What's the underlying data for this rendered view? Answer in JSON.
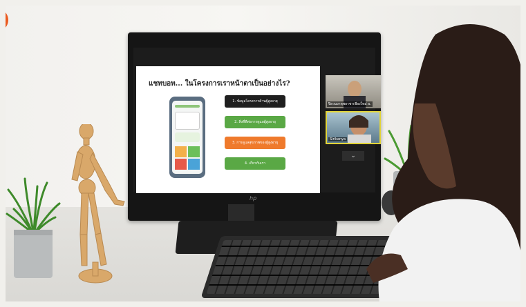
{
  "scene": {
    "description_colors": {
      "accent_badge": "#ea5a1f"
    }
  },
  "slide": {
    "title": "แชทบอท... ในโครงการเราหน้าตาเป็นอย่างไร?",
    "buttons": [
      {
        "label": "1. ข้อมูลโครงการด้านผู้สูงอายุ",
        "color": "#1f1f1f"
      },
      {
        "label": "2. สิ่งที่ดีต่อการดูแลผู้สูงอายุ",
        "color": "#5aa845"
      },
      {
        "label": "3. การดูแลสุขภาพของผู้สูงอายุ",
        "color": "#ef7a2c"
      },
      {
        "label": "4. เกี่ยวกับเรา",
        "color": "#5aa845"
      }
    ]
  },
  "video": {
    "participant_1": "ปิยวนงาดุพยาชาเชียงใหม่ ผ.",
    "participant_2": "Sirikanya"
  },
  "monitor": {
    "brand": "hp"
  }
}
